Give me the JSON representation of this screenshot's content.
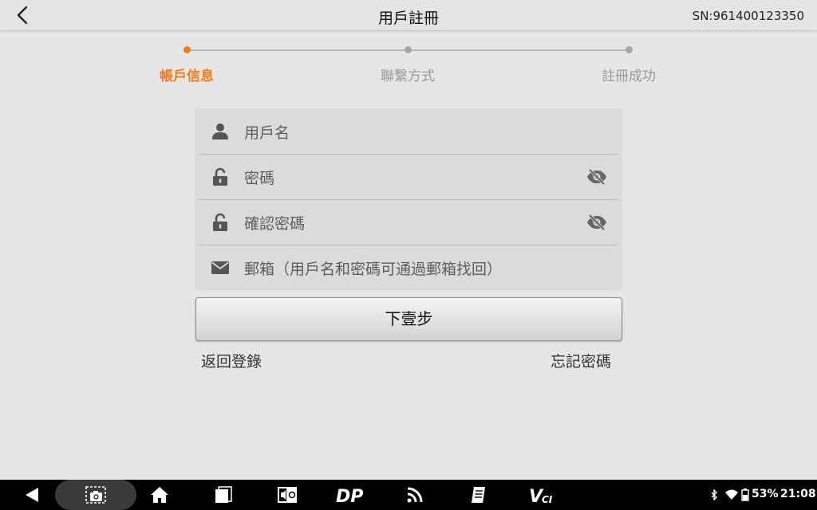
{
  "header": {
    "title": "用戶註冊",
    "serial": "SN:961400123350"
  },
  "steps": [
    {
      "label": "帳戶信息",
      "active": true
    },
    {
      "label": "聯繫方式",
      "active": false
    },
    {
      "label": "註冊成功",
      "active": false
    }
  ],
  "form": {
    "username_placeholder": "用戶名",
    "password_placeholder": "密碼",
    "confirm_password_placeholder": "確認密碼",
    "email_placeholder": "郵箱（用戶名和密碼可通過郵箱找回）"
  },
  "actions": {
    "next_label": "下壹步",
    "back_to_login": "返回登錄",
    "forgot_password": "忘記密碼"
  },
  "navbar": {
    "icons": [
      "back-icon",
      "screenshot-icon",
      "home-icon",
      "recent-apps-icon",
      "media-icon",
      "dp-icon",
      "vci-wireless-icon",
      "notes-icon",
      "vci-icon"
    ],
    "vci_label": "VCI",
    "dp_label": "DP"
  },
  "status": {
    "battery": "53%",
    "time": "21:08"
  },
  "colors": {
    "accent": "#f47a1f",
    "background": "#e6e6e6",
    "form_bg": "#d9dbdc"
  }
}
